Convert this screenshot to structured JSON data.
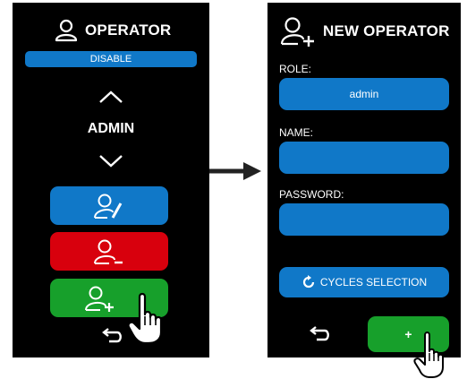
{
  "left_panel": {
    "title": "OPERATOR",
    "status_pill": "DISABLE",
    "role_value": "ADMIN",
    "buttons": [
      {
        "icon": "edit-user-icon",
        "color": "#1078c8"
      },
      {
        "icon": "remove-user-icon",
        "color": "#d8000d"
      },
      {
        "icon": "add-user-icon",
        "color": "#17a02b"
      }
    ],
    "back_icon": "return-arrow-icon"
  },
  "flow_arrow_icon": "right-arrow-icon",
  "right_panel": {
    "title": "NEW OPERATOR",
    "role_label": "ROLE:",
    "role_value": "admin",
    "name_label": "NAME:",
    "name_value": "",
    "password_label": "PASSWORD:",
    "password_value": "",
    "cycles_button": "CYCLES SELECTION",
    "cycles_icon": "refresh-icon",
    "confirm_button": "+",
    "back_icon": "return-arrow-icon"
  },
  "colors": {
    "blue": "#1078c8",
    "red": "#d8000d",
    "green": "#17a02b",
    "screen_bg": "#000000"
  },
  "pointer_icon": "hand-pointer-icon"
}
